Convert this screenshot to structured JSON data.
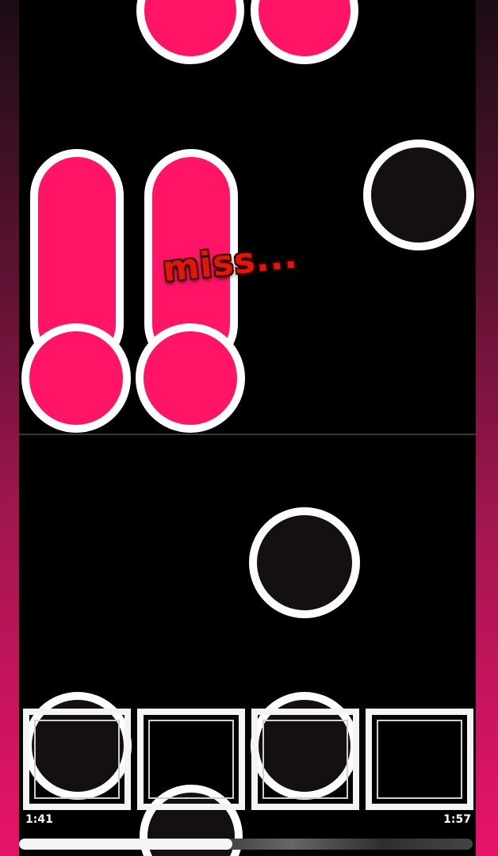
{
  "judgement": {
    "text": "miss..."
  },
  "playback": {
    "current_time": "1:41",
    "total_time": "1:57",
    "progress": 0.47
  },
  "lanes": 4,
  "colors": {
    "note_pink": "#ff1466",
    "note_dark": "#141011",
    "outline": "#ffffff",
    "judgement_miss": "#e0180c"
  }
}
